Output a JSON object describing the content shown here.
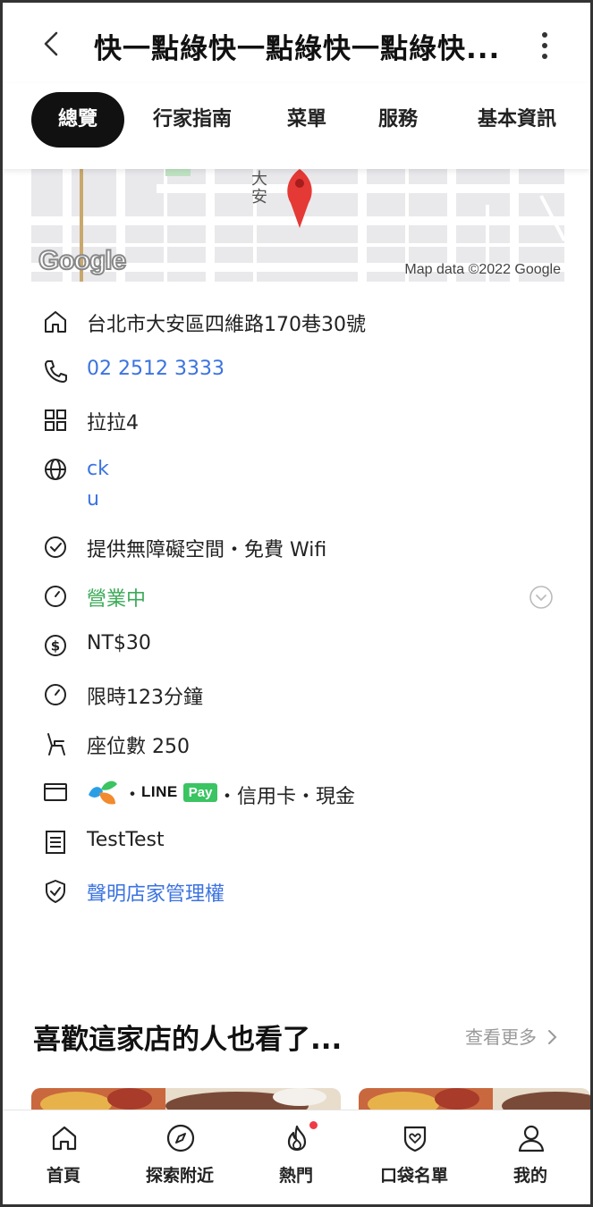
{
  "header": {
    "title": "快一點綠快一點綠快一點綠快...",
    "back_icon": "chevron-left-icon",
    "more_icon": "more-vertical-icon"
  },
  "tabs": [
    {
      "label": "總覽",
      "active": true
    },
    {
      "label": "行家指南",
      "active": false
    },
    {
      "label": "菜單",
      "active": false
    },
    {
      "label": "服務",
      "active": false
    },
    {
      "label": "基本資訊",
      "active": false
    }
  ],
  "map": {
    "street_label": "大安",
    "logo_text": "Google",
    "credit": "Map data ©2022 Google"
  },
  "info": {
    "address": "台北市大安區四維路170巷30號",
    "phone": "02 2512 3333",
    "category": "拉拉4",
    "website_line1": "ck",
    "website_line2": "u",
    "amenities": "提供無障礙空間・免費 Wifi",
    "open_status": "營業中",
    "price": "NT$30",
    "time_limit": "限時123分鐘",
    "seats": "座位數 250",
    "payment_dot1": "・",
    "payment_line": "LINE",
    "payment_pay": "Pay",
    "payment_rest": "・信用卡・現金",
    "note": "TestTest",
    "claim": "聲明店家管理權"
  },
  "recommend": {
    "title": "喜歡這家店的人也看了...",
    "see_more": "查看更多"
  },
  "bottom_nav": [
    {
      "label": "首頁",
      "icon": "home-icon"
    },
    {
      "label": "探索附近",
      "icon": "compass-icon"
    },
    {
      "label": "熱門",
      "icon": "flame-icon",
      "badge": true
    },
    {
      "label": "口袋名單",
      "icon": "bookmark-heart-icon"
    },
    {
      "label": "我的",
      "icon": "user-icon"
    }
  ],
  "colors": {
    "link_blue": "#3b73e0",
    "open_green": "#3daa5a",
    "badge_red": "#ef3b47",
    "tab_active": "#111111"
  }
}
